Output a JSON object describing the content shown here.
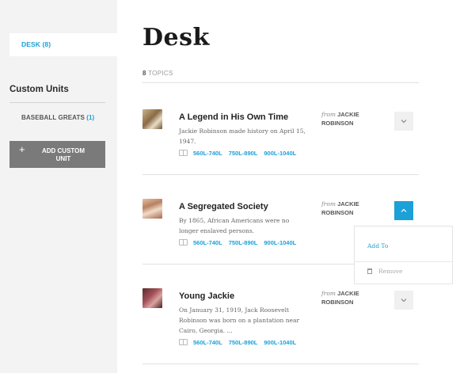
{
  "sidebar": {
    "desk_tab": "DESK (8)",
    "custom_units_heading": "Custom Units",
    "units": [
      {
        "name": "BASEBALL GREATS",
        "count": "(1)"
      }
    ],
    "add_button": "ADD CUSTOM UNIT",
    "add_icon": "+"
  },
  "main": {
    "title": "Desk",
    "topic_count": "8",
    "topic_count_label": "TOPICS",
    "topics": [
      {
        "title": "A Legend in His Own Time",
        "description": "Jackie Robinson made history on April 15, 1947.",
        "from_label": "from",
        "author": "JACKIE ROBINSON",
        "lexiles": [
          "560L-740L",
          "750L-890L",
          "900L-1040L"
        ],
        "expanded": false
      },
      {
        "title": "A Segregated Society",
        "description": "By 1865, African Americans were no longer enslaved persons.",
        "from_label": "from",
        "author": "JACKIE ROBINSON",
        "lexiles": [
          "560L-740L",
          "750L-890L",
          "900L-1040L"
        ],
        "expanded": true
      },
      {
        "title": "Young Jackie",
        "description": "On January 31, 1919, Jack Roosevelt Robinson was born on a plantation near Cairo, Georgia. ...",
        "from_label": "from",
        "author": "JACKIE ROBINSON",
        "lexiles": [
          "560L-740L",
          "750L-890L",
          "900L-1040L"
        ],
        "expanded": false
      }
    ],
    "dropdown": {
      "add_label": "Add To",
      "remove_label": "Remove"
    }
  },
  "colors": {
    "accent": "#1ba0d8",
    "sidebar_bg": "#f3f3f3",
    "button_bg": "#7a7a7a"
  }
}
